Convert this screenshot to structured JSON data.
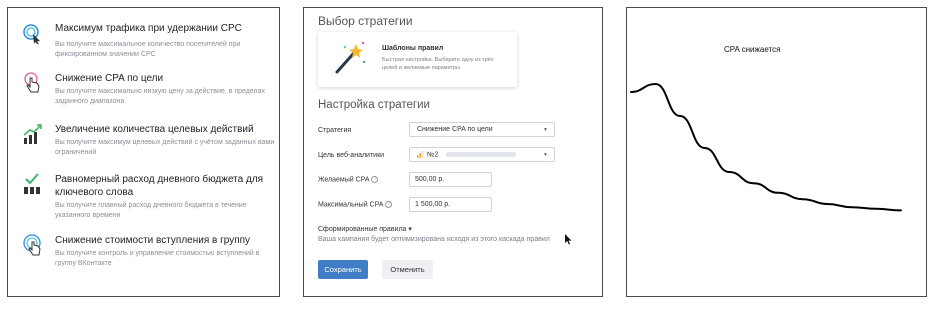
{
  "goals": [
    {
      "icon": "cursor-target-icon",
      "title": "Максимум трафика при удержании CPC",
      "desc": "Вы получите максимальное количество посетителей при фиксированном значении CPC"
    },
    {
      "icon": "finger-tap-icon",
      "title": "Снижение CPA по цели",
      "desc": "Вы получите максимально низкую цену за действие, в пределах заданного диапазона"
    },
    {
      "icon": "growth-chart-icon",
      "title": "Увеличение количества целевых действий",
      "desc": "Вы получите максимум целевых действий с учётом заданных вами ограничений"
    },
    {
      "icon": "check-bars-icon",
      "title": "Равномерный расход дневного бюджета для ключевого слова",
      "desc": "Вы получите плавный расход дневного бюджета в течение указанного времени"
    },
    {
      "icon": "group-tap-icon",
      "title": "Снижение стоимости вступления в группу",
      "desc": "Вы получите контроль и управление стоимостью вступлений в группу ВКонтакте"
    }
  ],
  "strategy": {
    "title": "Выбор стратегии",
    "template_title": "Шаблоны правил",
    "template_desc": "Быстрая настройка. Выберите одну из трёх целей и желаемые параметры",
    "settings_title": "Настройка стратегии",
    "fields": {
      "strategy_label": "Стратегия",
      "strategy_value": "Снижение CPA по цели",
      "analytics_label": "Цель веб-аналитики",
      "analytics_value": "№2",
      "desired_cpa_label": "Желаемый CPA",
      "desired_cpa_value": "500,00 р.",
      "max_cpa_label": "Максимальный CPA",
      "max_cpa_value": "1 500,00 р."
    },
    "help_glyph": "?",
    "rules_title": "Сформированные правила",
    "rules_caret": "▾",
    "rules_desc": "Ваша кампания будет оптимизирована исходя из этого каскада правил",
    "save_label": "Сохранить",
    "cancel_label": "Отменить",
    "accent_color": "#3f7ec6"
  },
  "chart_data": {
    "type": "line",
    "title": "CPA снижается",
    "xlabel": "",
    "ylabel": "",
    "series": [
      {
        "values": [
          85,
          90,
          70,
          50,
          35,
          28,
          22,
          18,
          15,
          13,
          12,
          11
        ]
      }
    ],
    "x": [
      0,
      1,
      2,
      3,
      4,
      5,
      6,
      7,
      8,
      9,
      10,
      11
    ],
    "ylim": [
      0,
      100
    ],
    "axes_visible": false
  }
}
